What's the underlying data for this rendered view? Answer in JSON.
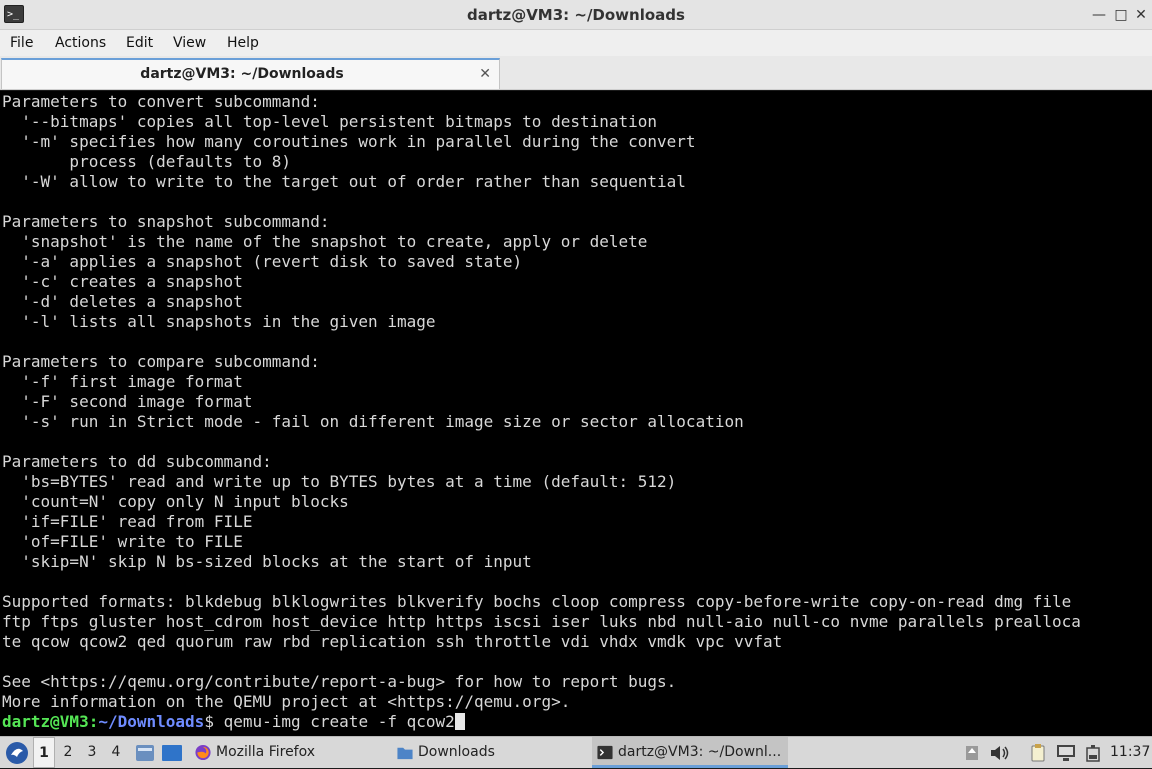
{
  "window": {
    "title": "dartz@VM3: ~/Downloads",
    "app_icon_glyph": ">_",
    "minimize_glyph": "—",
    "maximize_glyph": "□",
    "close_glyph": "✕"
  },
  "menu": {
    "file": "File",
    "actions": "Actions",
    "edit": "Edit",
    "view": "View",
    "help": "Help"
  },
  "tab": {
    "label": "dartz@VM3: ~/Downloads",
    "close_glyph": "✕",
    "accent_color": "#6a9fd8"
  },
  "terminal": {
    "colors": {
      "background": "#000000",
      "text": "#d8d8d8",
      "user": "#55e655",
      "path": "#6f8cff"
    },
    "lines": [
      "Parameters to convert subcommand:",
      "  '--bitmaps' copies all top-level persistent bitmaps to destination",
      "  '-m' specifies how many coroutines work in parallel during the convert",
      "       process (defaults to 8)",
      "  '-W' allow to write to the target out of order rather than sequential",
      "",
      "Parameters to snapshot subcommand:",
      "  'snapshot' is the name of the snapshot to create, apply or delete",
      "  '-a' applies a snapshot (revert disk to saved state)",
      "  '-c' creates a snapshot",
      "  '-d' deletes a snapshot",
      "  '-l' lists all snapshots in the given image",
      "",
      "Parameters to compare subcommand:",
      "  '-f' first image format",
      "  '-F' second image format",
      "  '-s' run in Strict mode - fail on different image size or sector allocation",
      "",
      "Parameters to dd subcommand:",
      "  'bs=BYTES' read and write up to BYTES bytes at a time (default: 512)",
      "  'count=N' copy only N input blocks",
      "  'if=FILE' read from FILE",
      "  'of=FILE' write to FILE",
      "  'skip=N' skip N bs-sized blocks at the start of input",
      "",
      "Supported formats: blkdebug blklogwrites blkverify bochs cloop compress copy-before-write copy-on-read dmg file",
      "ftp ftps gluster host_cdrom host_device http https iscsi iser luks nbd null-aio null-co nvme parallels prealloca",
      "te qcow qcow2 qed quorum raw rbd replication ssh throttle vdi vhdx vmdk vpc vvfat",
      "",
      "See <https://qemu.org/contribute/report-a-bug> for how to report bugs.",
      "More information on the QEMU project at <https://qemu.org>."
    ],
    "prompt": {
      "user": "dartz@VM3",
      "sep": ":",
      "path": "~/Downloads",
      "dollar": "$ ",
      "command": "qemu-img create -f qcow2"
    }
  },
  "taskbar": {
    "workspaces": [
      "1",
      "2",
      "3",
      "4"
    ],
    "active_workspace": "1",
    "tasks": {
      "firefox": "Mozilla Firefox",
      "downloads": "Downloads",
      "terminal": "dartz@VM3: ~/Downl..."
    },
    "clock": "11:37"
  }
}
